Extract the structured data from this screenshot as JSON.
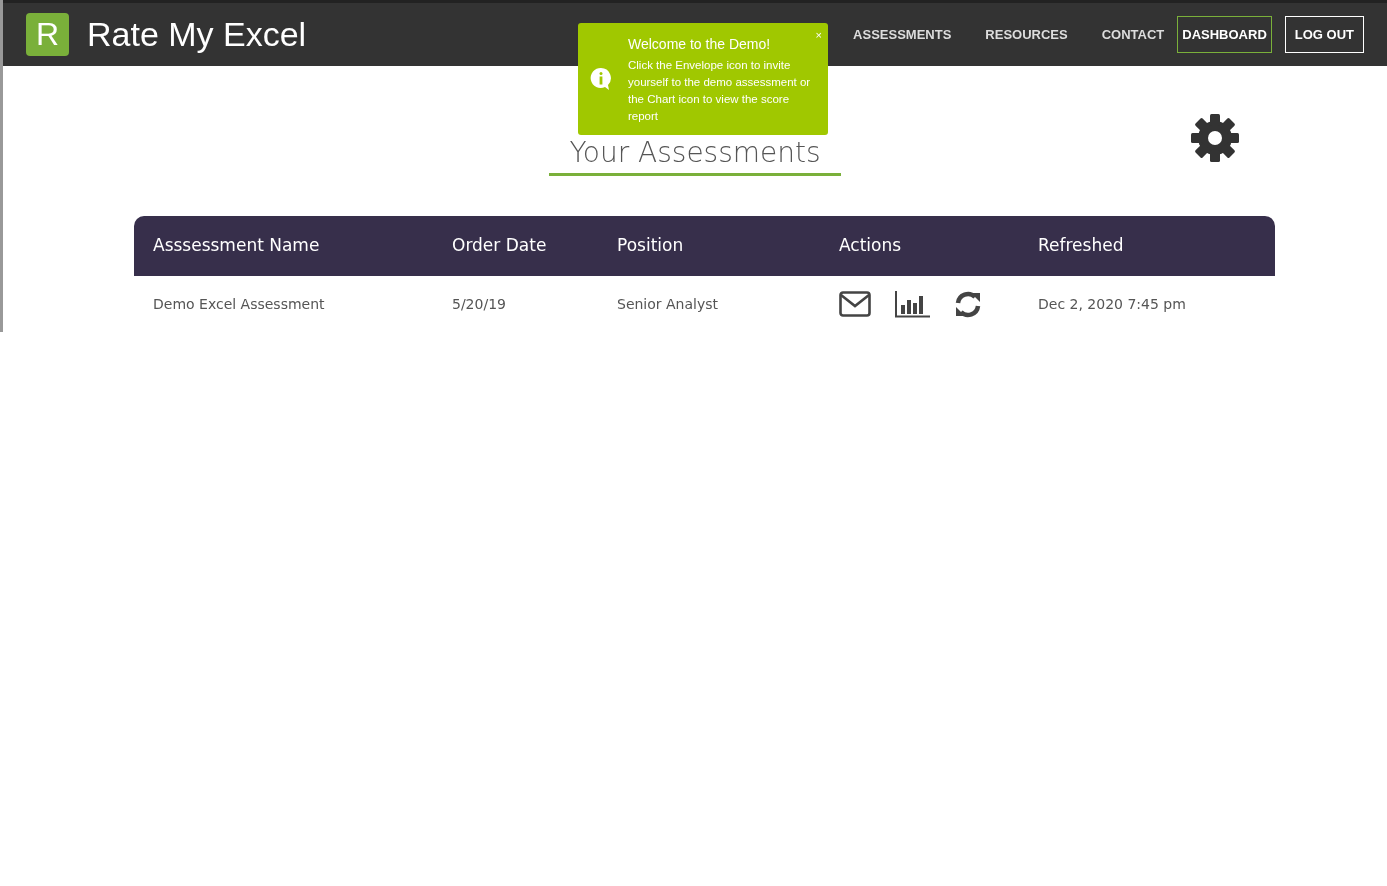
{
  "brand": {
    "logo_letter": "R",
    "name": "Rate My Excel"
  },
  "nav": [
    {
      "label": "ASSESSMENTS",
      "kind": "link",
      "selected": false
    },
    {
      "label": "RESOURCES",
      "kind": "link",
      "selected": false
    },
    {
      "label": "CONTACT",
      "kind": "link",
      "selected": false
    },
    {
      "label": "DASHBOARD",
      "kind": "button",
      "selected": true
    },
    {
      "label": "LOG OUT",
      "kind": "button",
      "selected": false
    }
  ],
  "toast": {
    "title": "Welcome to the Demo!",
    "message": "Click the Envelope icon to invite yourself to the demo assessment or the Chart icon to view the score report",
    "close": "×"
  },
  "page_title": "Your Assessments",
  "table": {
    "columns": [
      "Asssessment Name",
      "Order Date",
      "Position",
      "Actions",
      "Refreshed"
    ],
    "rows": [
      {
        "name": "Demo Excel Assessment",
        "order_date": "5/20/19",
        "position": "Senior Analyst",
        "actions": [
          {
            "kind": "envelope"
          },
          {
            "kind": "chart"
          },
          {
            "kind": "refresh"
          }
        ],
        "refreshed": "Dec 2, 2020 7:45 pm"
      }
    ]
  }
}
